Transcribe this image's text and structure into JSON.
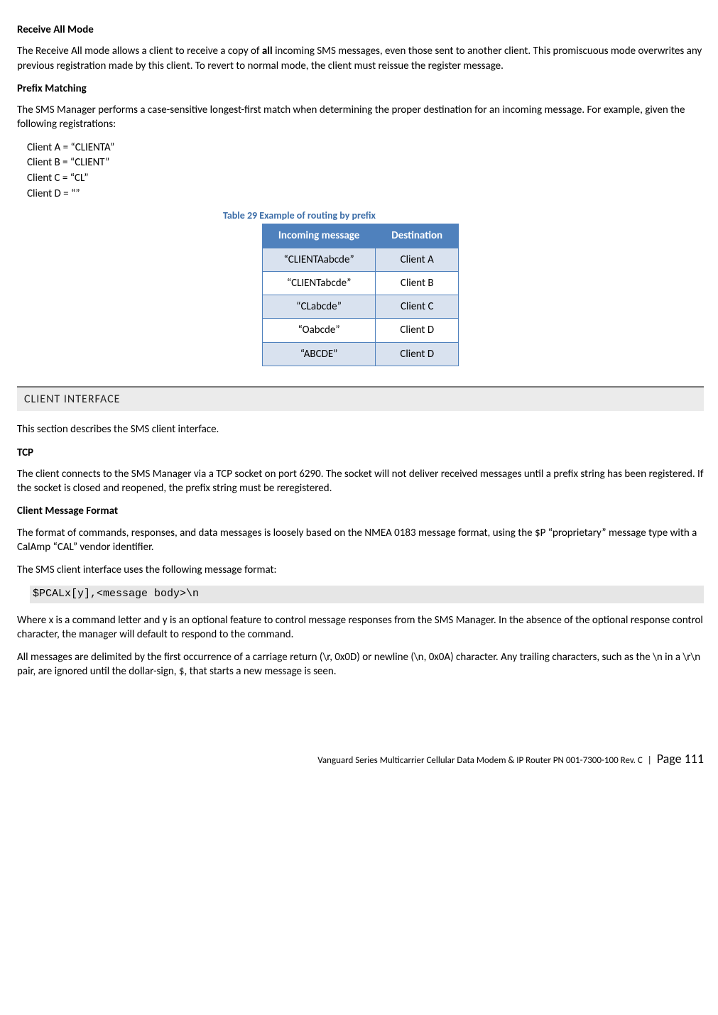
{
  "section1": {
    "heading": "Receive All Mode",
    "para": "The Receive All mode allows a client to receive a copy of all incoming SMS messages, even those sent to another client. This promiscuous mode overwrites any previous registration made by this client. To revert to normal mode, the client must reissue the register message.",
    "bold_word": "all"
  },
  "section2": {
    "heading": "Prefix Matching",
    "para": "The SMS Manager performs a case-sensitive longest-first match when determining the proper destination for an incoming message. For example, given the following registrations:",
    "clients": {
      "a": "Client A = “CLIENTA”",
      "b": "Client B = “CLIENT”",
      "c": "Client C = “CL”",
      "d": "Client D = “”"
    }
  },
  "table": {
    "caption": "Table 29 Example of routing by prefix",
    "headers": {
      "col1": "Incoming message",
      "col2": "Destination"
    },
    "rows": [
      {
        "msg": "“CLIENTAabcde”",
        "dest": "Client A"
      },
      {
        "msg": "“CLIENTabcde”",
        "dest": "Client B"
      },
      {
        "msg": "“CLabcde”",
        "dest": "Client C"
      },
      {
        "msg": "“Oabcde”",
        "dest": "Client D"
      },
      {
        "msg": "“ABCDE”",
        "dest": "Client D"
      }
    ]
  },
  "section3": {
    "bar": "CLIENT INTERFACE",
    "intro": "This section describes the SMS client interface.",
    "tcp_heading": "TCP",
    "tcp_para": "The client connects to the SMS Manager via a TCP socket on port 6290. The socket will not deliver received messages until a prefix string has been registered. If the socket is closed and reopened, the prefix string must be reregistered.",
    "fmt_heading": "Client Message Format",
    "fmt_para1": "The format of commands, responses, and data messages is loosely based on the NMEA 0183 message format, using the $P “proprietary” message type with a CalAmp “CAL” vendor identifier.",
    "fmt_para2": "The SMS client interface uses the following message format:",
    "code": "$PCALx[y],<message body>\\n",
    "fmt_para3": "Where x is a command letter and y is an optional feature to control message responses from the SMS Manager. In the absence of the optional response control character, the manager will default to respond to the command.",
    "fmt_para4": "All messages are delimited by the first occurrence of a carriage return (\\r, 0x0D) or newline (\\n, 0x0A) character. Any trailing characters, such as the \\n in a \\r\\n pair, are ignored until the dollar-sign, $, that starts a new message is seen."
  },
  "footer": {
    "left": "Vanguard Series Multicarrier Cellular Data Modem & IP Router PN 001-7300-100 Rev. C",
    "sep": "|",
    "right": "Page 111"
  }
}
